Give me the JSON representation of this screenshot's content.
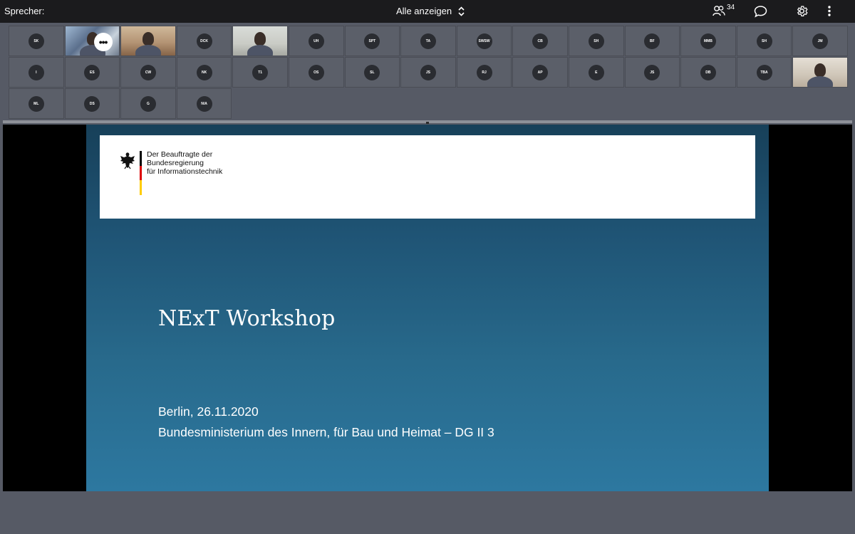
{
  "topbar": {
    "speaker_label": "Sprecher:",
    "view_label": "Alle anzeigen",
    "participants_count": "34",
    "icons": [
      "people-icon",
      "chat-icon",
      "gear-icon",
      "more-vertical-icon",
      "chevron-up-down-icon"
    ]
  },
  "participants": [
    {
      "initials": "SK"
    },
    {
      "video": true
    },
    {
      "video": true
    },
    {
      "initials": "DCK"
    },
    {
      "video": true
    },
    {
      "initials": "UH"
    },
    {
      "initials": "SPT"
    },
    {
      "initials": "TA"
    },
    {
      "initials": "SWSW"
    },
    {
      "initials": "CB"
    },
    {
      "initials": "SH"
    },
    {
      "initials": "BF"
    },
    {
      "initials": "MMB"
    },
    {
      "initials": "SH"
    },
    {
      "initials": "JM"
    },
    {
      "initials": "I"
    },
    {
      "initials": "ES"
    },
    {
      "initials": "CW"
    },
    {
      "initials": "NK"
    },
    {
      "initials": "T1"
    },
    {
      "initials": "OS"
    },
    {
      "initials": "SL"
    },
    {
      "initials": "JS"
    },
    {
      "initials": "RJ"
    },
    {
      "initials": "AP"
    },
    {
      "initials": "E"
    },
    {
      "initials": "JS"
    },
    {
      "initials": "DB"
    },
    {
      "initials": "TBA"
    },
    {
      "video": true
    },
    {
      "initials": "ML"
    },
    {
      "initials": "DS"
    },
    {
      "initials": "G"
    },
    {
      "initials": "N/A"
    }
  ],
  "slide": {
    "logo_lines": [
      "Der Beauftragte der",
      "Bundesregierung",
      "für Informationstechnik"
    ],
    "title": "NExT Workshop",
    "date_line": "Berlin, 26.11.2020",
    "org_line": "Bundesministerium des Innern, für Bau und Heimat – DG II 3"
  },
  "colors": {
    "topbar_bg": "#1b1b1d",
    "app_bg": "#565a65",
    "tile_bg": "#5b5f69",
    "slide_top": "#174059",
    "slide_bottom": "#2d78a0",
    "flag_black": "#000000",
    "flag_red": "#dd0000",
    "flag_gold": "#ffcc00"
  }
}
